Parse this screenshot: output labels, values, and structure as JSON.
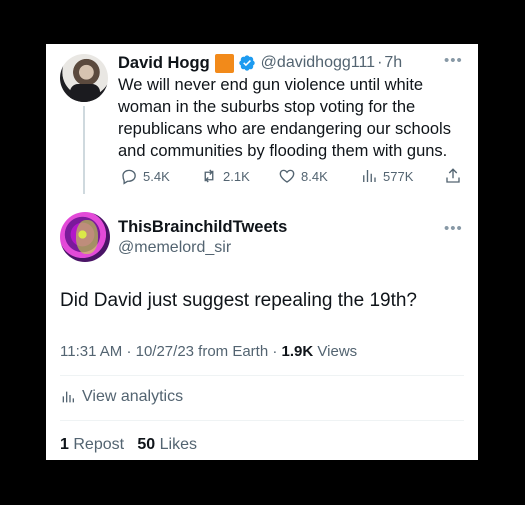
{
  "parent_tweet": {
    "author_name": "David Hogg",
    "emoji": "orange-square",
    "verified": true,
    "handle": "@davidhogg111",
    "separator": "·",
    "time": "7h",
    "text": "We will never end gun violence until white woman in the suburbs stop voting for the republicans who are endangering our schools and communities by flooding them with guns.",
    "replies": "5.4K",
    "reposts": "2.1K",
    "likes": "8.4K",
    "views": "577K"
  },
  "tweet": {
    "author_name": "ThisBrainchildTweets",
    "handle": "@memelord_sir",
    "text": "Did David just suggest repealing the 19th?",
    "time": "11:31 AM",
    "date": "10/27/23",
    "source": "from Earth",
    "separator": "·",
    "views_count": "1.9K",
    "views_label": "Views",
    "analytics_label": "View analytics",
    "repost_count": "1",
    "repost_label": "Repost",
    "like_count": "50",
    "like_label": "Likes"
  },
  "colors": {
    "text_primary": "#0f1419",
    "text_secondary": "#536471",
    "verified_blue": "#1d9bf0",
    "emoji_orange": "#f28a1a"
  }
}
